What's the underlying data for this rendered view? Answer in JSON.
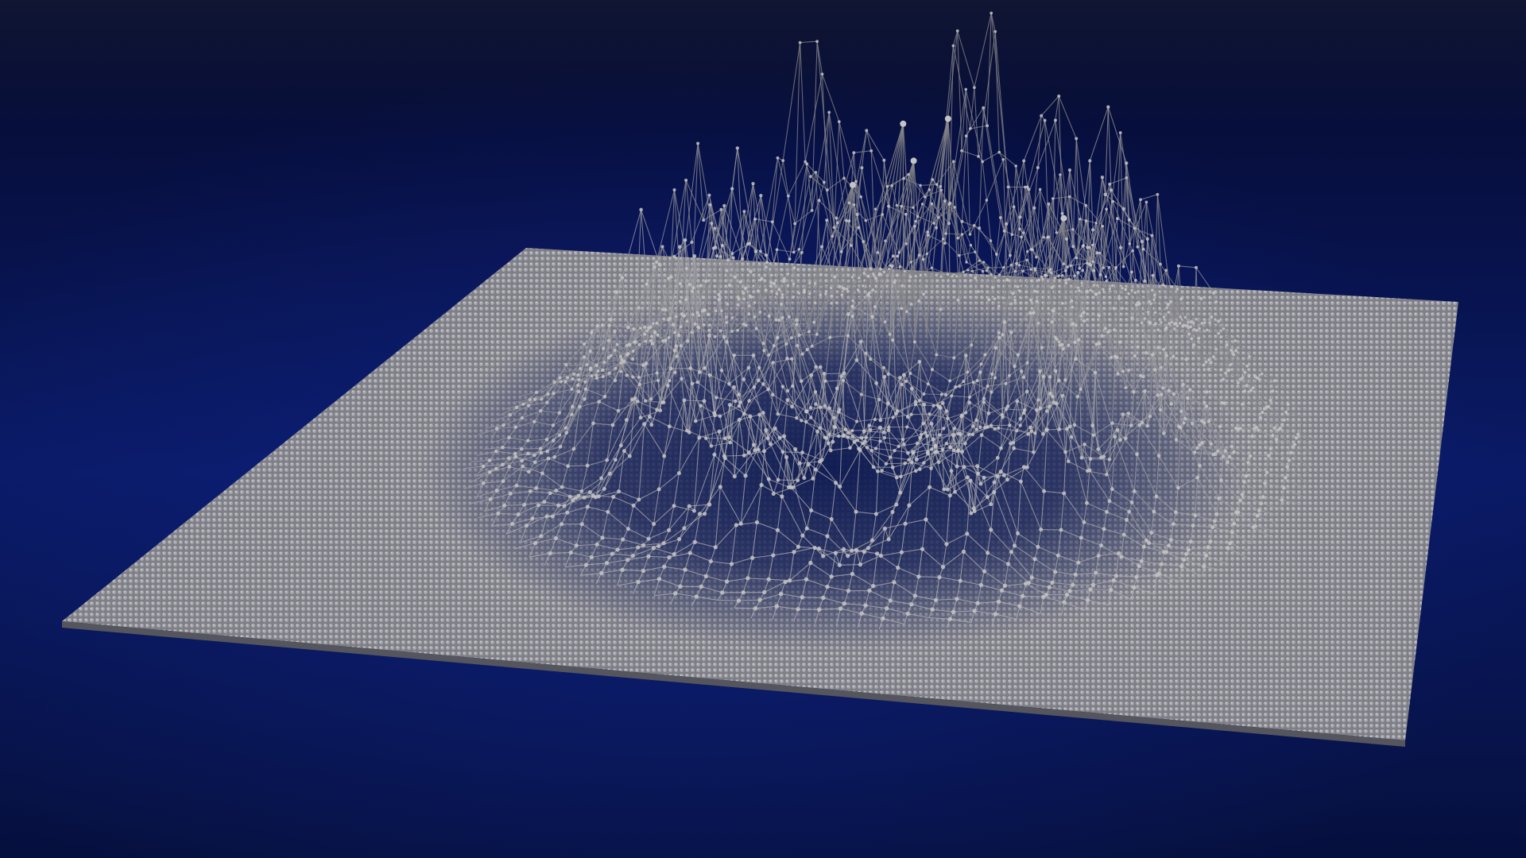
{
  "scene": {
    "subject": "",
    "colors": {
      "background_top": "#050a2c",
      "background_mid": "#0a1a66",
      "background_bottom": "#06103e",
      "mesh_base": "#8a8a8a",
      "mesh_highlight": "#c4c4c4",
      "mesh_shadow": "#3c3c48"
    }
  }
}
